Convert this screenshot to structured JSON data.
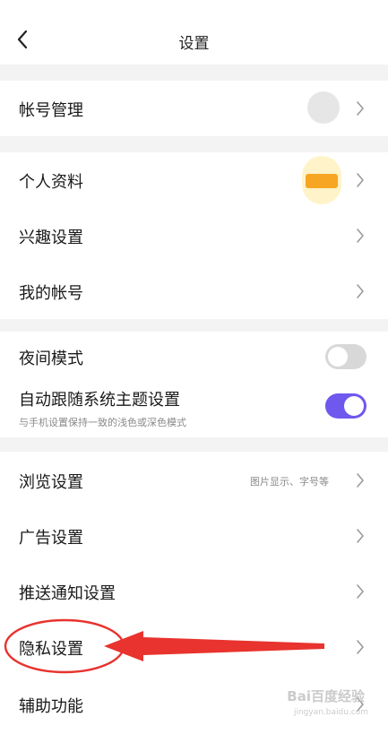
{
  "header": {
    "title": "设置",
    "back_icon": "chevron-left-icon"
  },
  "sections": {
    "account": {
      "account_management": "帐号管理"
    },
    "profile": {
      "personal_info": "个人资料",
      "interest_settings": "兴趣设置",
      "my_account": "我的帐号"
    },
    "display": {
      "night_mode": "夜间模式",
      "night_mode_on": false,
      "follow_system_theme": "自动跟随系统主题设置",
      "follow_system_theme_sub": "与手机设置保持一致的浅色或深色模式",
      "follow_system_theme_on": true
    },
    "settings": {
      "browse_settings": "浏览设置",
      "browse_settings_hint": "图片显示、字号等",
      "ad_settings": "广告设置",
      "push_settings": "推送通知设置",
      "privacy_settings": "隐私设置",
      "accessibility": "辅助功能"
    }
  },
  "colors": {
    "toggle_on": "#6f58ee",
    "toggle_off": "#d8d8d8",
    "annotation": "#e8332e",
    "avatar_orange": "#f6a623",
    "avatar_gray": "#d9d9d9",
    "divider": "#f3f3f3"
  },
  "watermark": {
    "brand": "Bai百度经验",
    "url": "jingyan.baidu.com"
  }
}
